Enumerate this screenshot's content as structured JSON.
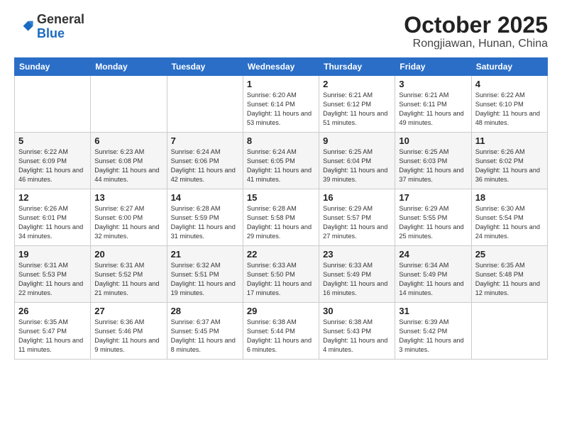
{
  "header": {
    "logo_general": "General",
    "logo_blue": "Blue",
    "month_title": "October 2025",
    "location": "Rongjiawan, Hunan, China"
  },
  "weekdays": [
    "Sunday",
    "Monday",
    "Tuesday",
    "Wednesday",
    "Thursday",
    "Friday",
    "Saturday"
  ],
  "weeks": [
    [
      {
        "day": "",
        "info": ""
      },
      {
        "day": "",
        "info": ""
      },
      {
        "day": "",
        "info": ""
      },
      {
        "day": "1",
        "info": "Sunrise: 6:20 AM\nSunset: 6:14 PM\nDaylight: 11 hours\nand 53 minutes."
      },
      {
        "day": "2",
        "info": "Sunrise: 6:21 AM\nSunset: 6:12 PM\nDaylight: 11 hours\nand 51 minutes."
      },
      {
        "day": "3",
        "info": "Sunrise: 6:21 AM\nSunset: 6:11 PM\nDaylight: 11 hours\nand 49 minutes."
      },
      {
        "day": "4",
        "info": "Sunrise: 6:22 AM\nSunset: 6:10 PM\nDaylight: 11 hours\nand 48 minutes."
      }
    ],
    [
      {
        "day": "5",
        "info": "Sunrise: 6:22 AM\nSunset: 6:09 PM\nDaylight: 11 hours\nand 46 minutes."
      },
      {
        "day": "6",
        "info": "Sunrise: 6:23 AM\nSunset: 6:08 PM\nDaylight: 11 hours\nand 44 minutes."
      },
      {
        "day": "7",
        "info": "Sunrise: 6:24 AM\nSunset: 6:06 PM\nDaylight: 11 hours\nand 42 minutes."
      },
      {
        "day": "8",
        "info": "Sunrise: 6:24 AM\nSunset: 6:05 PM\nDaylight: 11 hours\nand 41 minutes."
      },
      {
        "day": "9",
        "info": "Sunrise: 6:25 AM\nSunset: 6:04 PM\nDaylight: 11 hours\nand 39 minutes."
      },
      {
        "day": "10",
        "info": "Sunrise: 6:25 AM\nSunset: 6:03 PM\nDaylight: 11 hours\nand 37 minutes."
      },
      {
        "day": "11",
        "info": "Sunrise: 6:26 AM\nSunset: 6:02 PM\nDaylight: 11 hours\nand 36 minutes."
      }
    ],
    [
      {
        "day": "12",
        "info": "Sunrise: 6:26 AM\nSunset: 6:01 PM\nDaylight: 11 hours\nand 34 minutes."
      },
      {
        "day": "13",
        "info": "Sunrise: 6:27 AM\nSunset: 6:00 PM\nDaylight: 11 hours\nand 32 minutes."
      },
      {
        "day": "14",
        "info": "Sunrise: 6:28 AM\nSunset: 5:59 PM\nDaylight: 11 hours\nand 31 minutes."
      },
      {
        "day": "15",
        "info": "Sunrise: 6:28 AM\nSunset: 5:58 PM\nDaylight: 11 hours\nand 29 minutes."
      },
      {
        "day": "16",
        "info": "Sunrise: 6:29 AM\nSunset: 5:57 PM\nDaylight: 11 hours\nand 27 minutes."
      },
      {
        "day": "17",
        "info": "Sunrise: 6:29 AM\nSunset: 5:55 PM\nDaylight: 11 hours\nand 25 minutes."
      },
      {
        "day": "18",
        "info": "Sunrise: 6:30 AM\nSunset: 5:54 PM\nDaylight: 11 hours\nand 24 minutes."
      }
    ],
    [
      {
        "day": "19",
        "info": "Sunrise: 6:31 AM\nSunset: 5:53 PM\nDaylight: 11 hours\nand 22 minutes."
      },
      {
        "day": "20",
        "info": "Sunrise: 6:31 AM\nSunset: 5:52 PM\nDaylight: 11 hours\nand 21 minutes."
      },
      {
        "day": "21",
        "info": "Sunrise: 6:32 AM\nSunset: 5:51 PM\nDaylight: 11 hours\nand 19 minutes."
      },
      {
        "day": "22",
        "info": "Sunrise: 6:33 AM\nSunset: 5:50 PM\nDaylight: 11 hours\nand 17 minutes."
      },
      {
        "day": "23",
        "info": "Sunrise: 6:33 AM\nSunset: 5:49 PM\nDaylight: 11 hours\nand 16 minutes."
      },
      {
        "day": "24",
        "info": "Sunrise: 6:34 AM\nSunset: 5:49 PM\nDaylight: 11 hours\nand 14 minutes."
      },
      {
        "day": "25",
        "info": "Sunrise: 6:35 AM\nSunset: 5:48 PM\nDaylight: 11 hours\nand 12 minutes."
      }
    ],
    [
      {
        "day": "26",
        "info": "Sunrise: 6:35 AM\nSunset: 5:47 PM\nDaylight: 11 hours\nand 11 minutes."
      },
      {
        "day": "27",
        "info": "Sunrise: 6:36 AM\nSunset: 5:46 PM\nDaylight: 11 hours\nand 9 minutes."
      },
      {
        "day": "28",
        "info": "Sunrise: 6:37 AM\nSunset: 5:45 PM\nDaylight: 11 hours\nand 8 minutes."
      },
      {
        "day": "29",
        "info": "Sunrise: 6:38 AM\nSunset: 5:44 PM\nDaylight: 11 hours\nand 6 minutes."
      },
      {
        "day": "30",
        "info": "Sunrise: 6:38 AM\nSunset: 5:43 PM\nDaylight: 11 hours\nand 4 minutes."
      },
      {
        "day": "31",
        "info": "Sunrise: 6:39 AM\nSunset: 5:42 PM\nDaylight: 11 hours\nand 3 minutes."
      },
      {
        "day": "",
        "info": ""
      }
    ]
  ]
}
